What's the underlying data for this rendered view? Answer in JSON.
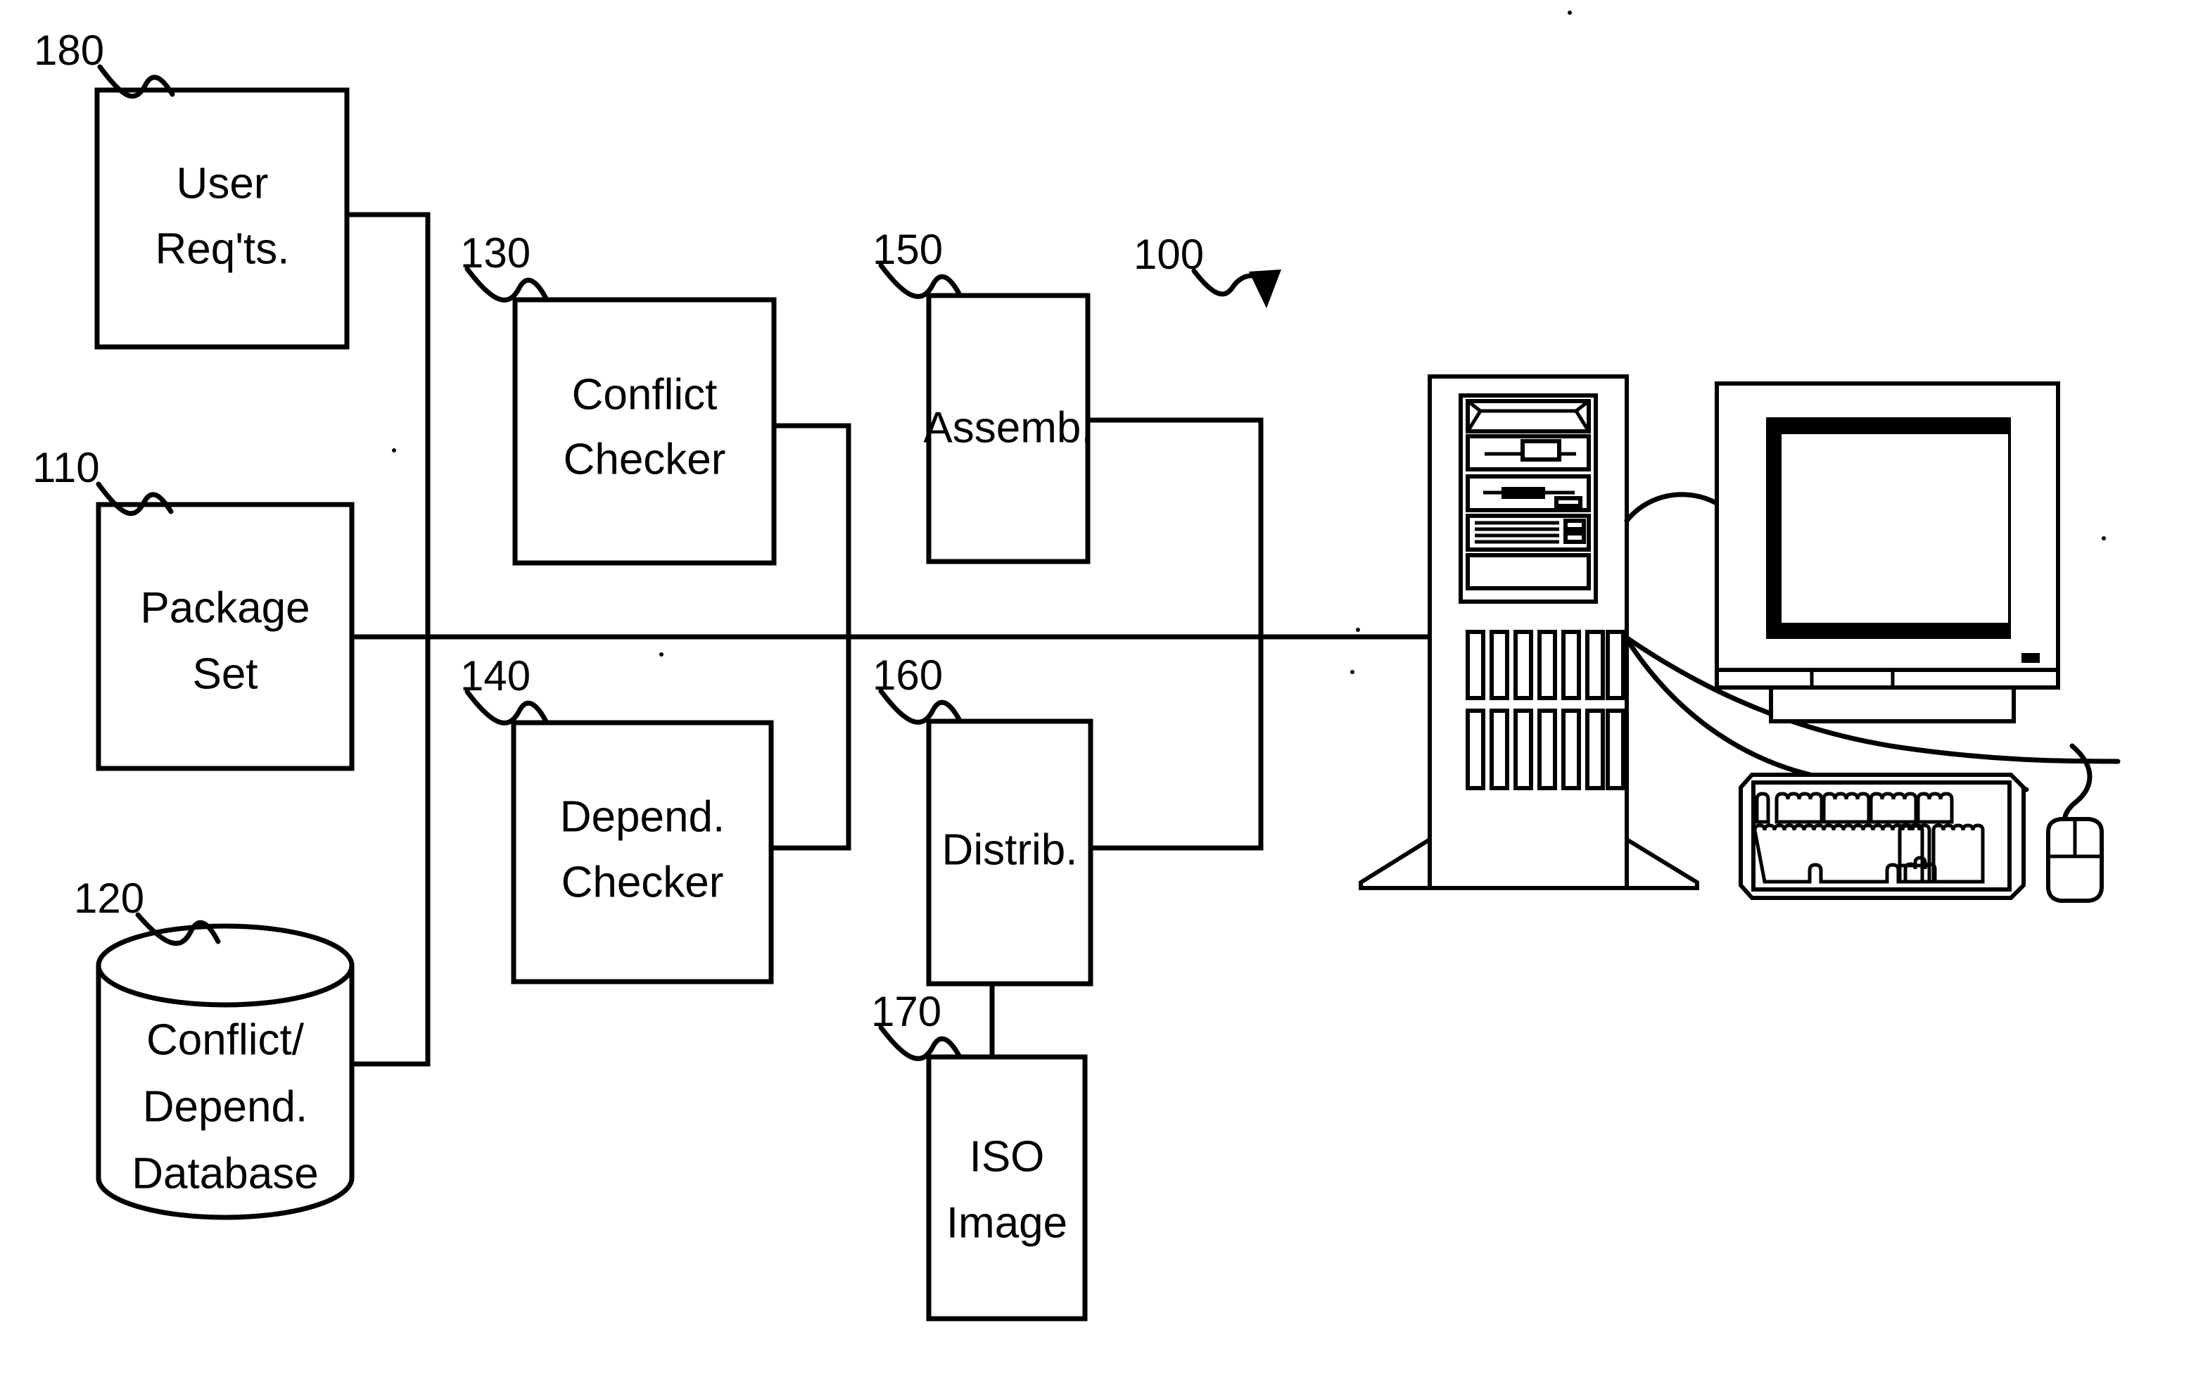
{
  "figure": {
    "kind": "patent-block-diagram",
    "background_color": "#ffffff",
    "line_color": "#000000"
  },
  "blocks": [
    {
      "id": "user-requirements",
      "ref": "180",
      "label_line1": "User",
      "label_line2": "Req'ts.",
      "label_line3": "",
      "shape": "rectangle"
    },
    {
      "id": "package-set",
      "ref": "110",
      "label_line1": "Package",
      "label_line2": "Set",
      "label_line3": "",
      "shape": "rectangle"
    },
    {
      "id": "conflict-depend-database",
      "ref": "120",
      "label_line1": "Conflict/",
      "label_line2": "Depend.",
      "label_line3": "Database",
      "shape": "cylinder"
    },
    {
      "id": "conflict-checker",
      "ref": "130",
      "label_line1": "Conflict",
      "label_line2": "Checker",
      "label_line3": "",
      "shape": "rectangle"
    },
    {
      "id": "depend-checker",
      "ref": "140",
      "label_line1": "Depend.",
      "label_line2": "Checker",
      "label_line3": "",
      "shape": "rectangle"
    },
    {
      "id": "assembler",
      "ref": "150",
      "label_line1": "Assemb.",
      "label_line2": "",
      "label_line3": "",
      "shape": "rectangle"
    },
    {
      "id": "distributor",
      "ref": "160",
      "label_line1": "Distrib.",
      "label_line2": "",
      "label_line3": "",
      "shape": "rectangle"
    },
    {
      "id": "iso-image",
      "ref": "170",
      "label_line1": "ISO",
      "label_line2": "Image",
      "label_line3": "",
      "shape": "rectangle"
    }
  ],
  "reference_numerals": {
    "user_requirements": "180",
    "package_set": "110",
    "database": "120",
    "conflict_checker": "130",
    "depend_checker": "140",
    "assembler": "150",
    "distributor": "160",
    "iso_image": "170",
    "system_overall": "100"
  },
  "labels": {
    "user_requirements_line1": "User",
    "user_requirements_line2": "Req'ts.",
    "package_set_line1": "Package",
    "package_set_line2": "Set",
    "database_line1": "Conflict/",
    "database_line2": "Depend.",
    "database_line3": "Database",
    "conflict_checker_line1": "Conflict",
    "conflict_checker_line2": "Checker",
    "depend_checker_line1": "Depend.",
    "depend_checker_line2": "Checker",
    "assembler_line1": "Assemb.",
    "distributor_line1": "Distrib.",
    "iso_image_line1": "ISO",
    "iso_image_line2": "Image"
  },
  "hardware": {
    "tower": "computer-tower",
    "monitor": "crt-monitor",
    "keyboard": "keyboard",
    "mouse": "mouse"
  }
}
